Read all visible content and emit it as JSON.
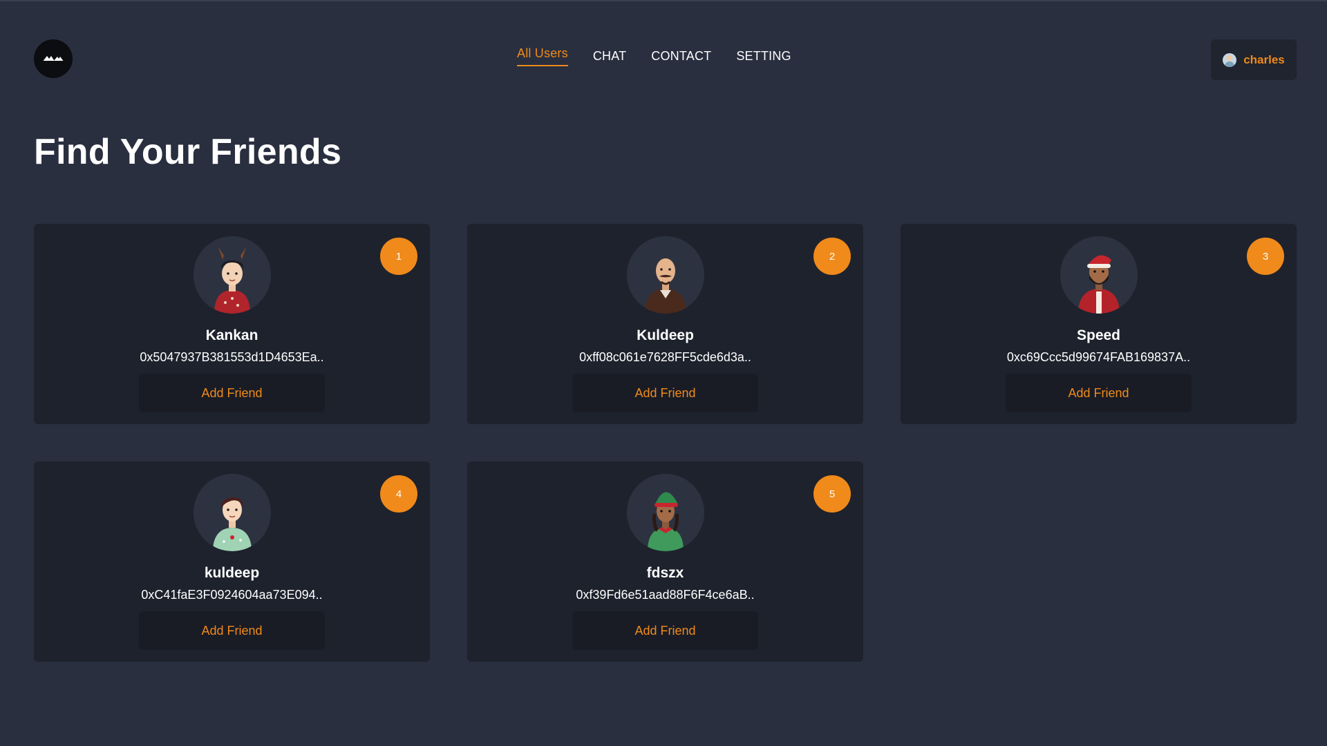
{
  "header": {
    "logo_icon": "mountain-logo-icon",
    "nav": [
      {
        "label": "All Users",
        "active": true
      },
      {
        "label": "CHAT",
        "active": false
      },
      {
        "label": "CONTACT",
        "active": false
      },
      {
        "label": "SETTING",
        "active": false
      }
    ],
    "user": {
      "name": "charles",
      "avatar_icon": "user-avatar-icon"
    }
  },
  "main": {
    "title": "Find Your Friends"
  },
  "users": [
    {
      "rank": "1",
      "name": "Kankan",
      "address": "0x5047937B381553d1D4653Ea..",
      "button": "Add Friend",
      "avatar": "reindeer-sweater-avatar"
    },
    {
      "rank": "2",
      "name": "Kuldeep",
      "address": "0xff08c061e7628FF5cde6d3a..",
      "button": "Add Friend",
      "avatar": "bald-mustache-avatar"
    },
    {
      "rank": "3",
      "name": "Speed",
      "address": "0xc69Ccc5d99674FAB169837A..",
      "button": "Add Friend",
      "avatar": "santa-hat-beard-avatar"
    },
    {
      "rank": "4",
      "name": "kuldeep",
      "address": "0xC41faE3F0924604aa73E094..",
      "button": "Add Friend",
      "avatar": "green-sweater-avatar"
    },
    {
      "rank": "5",
      "name": "fdszx",
      "address": "0xf39Fd6e51aad88F6F4ce6aB..",
      "button": "Add Friend",
      "avatar": "elf-hat-avatar"
    }
  ],
  "colors": {
    "background": "#292f3f",
    "card": "#1e222d",
    "button": "#191c25",
    "accent": "#f08a1b",
    "text": "#ffffff"
  }
}
